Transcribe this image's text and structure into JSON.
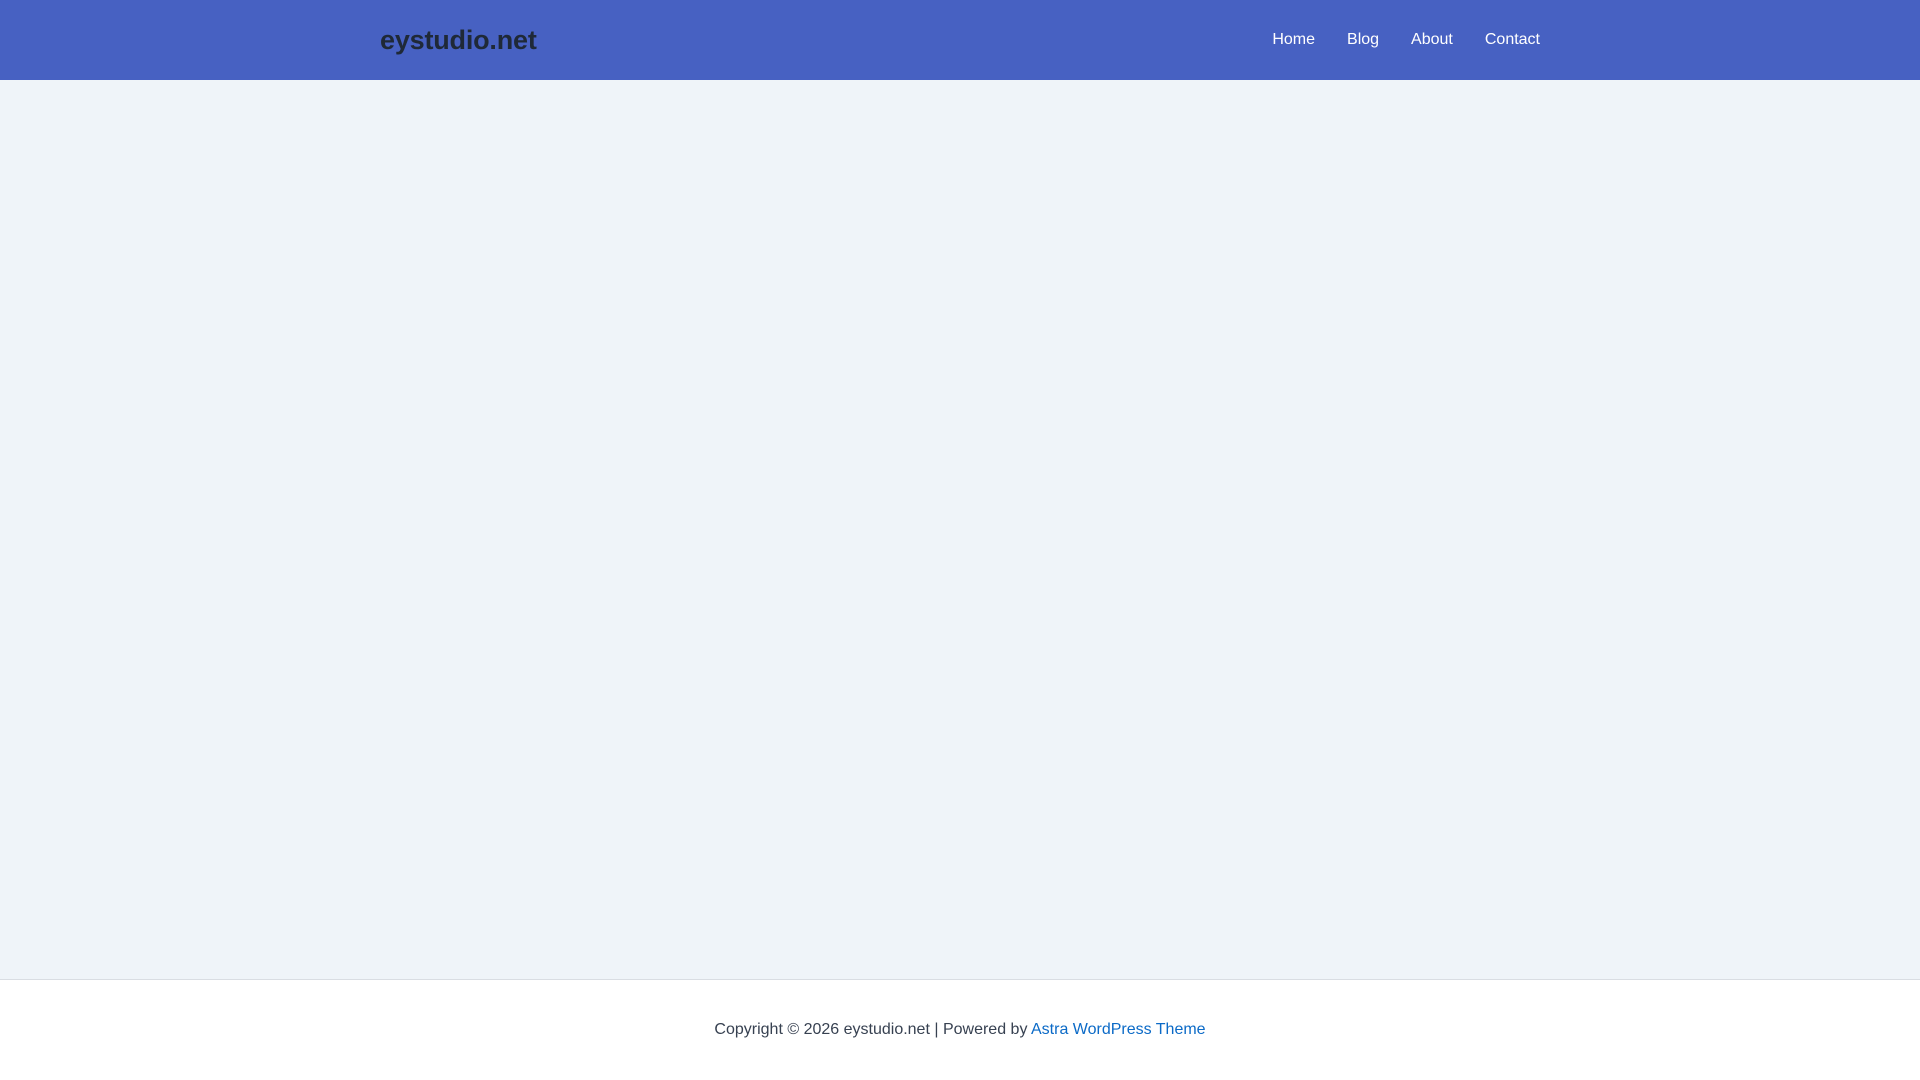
{
  "header": {
    "site_title": "eystudio.net",
    "background_color": "#4761c2",
    "nav": [
      {
        "label": "Home"
      },
      {
        "label": "Blog"
      },
      {
        "label": "About"
      },
      {
        "label": "Contact"
      }
    ]
  },
  "footer": {
    "copyright_text": "Copyright © 2026 eystudio.net | Powered by",
    "theme_link_label": "Astra WordPress Theme",
    "link_color": "#0b6ac7"
  }
}
